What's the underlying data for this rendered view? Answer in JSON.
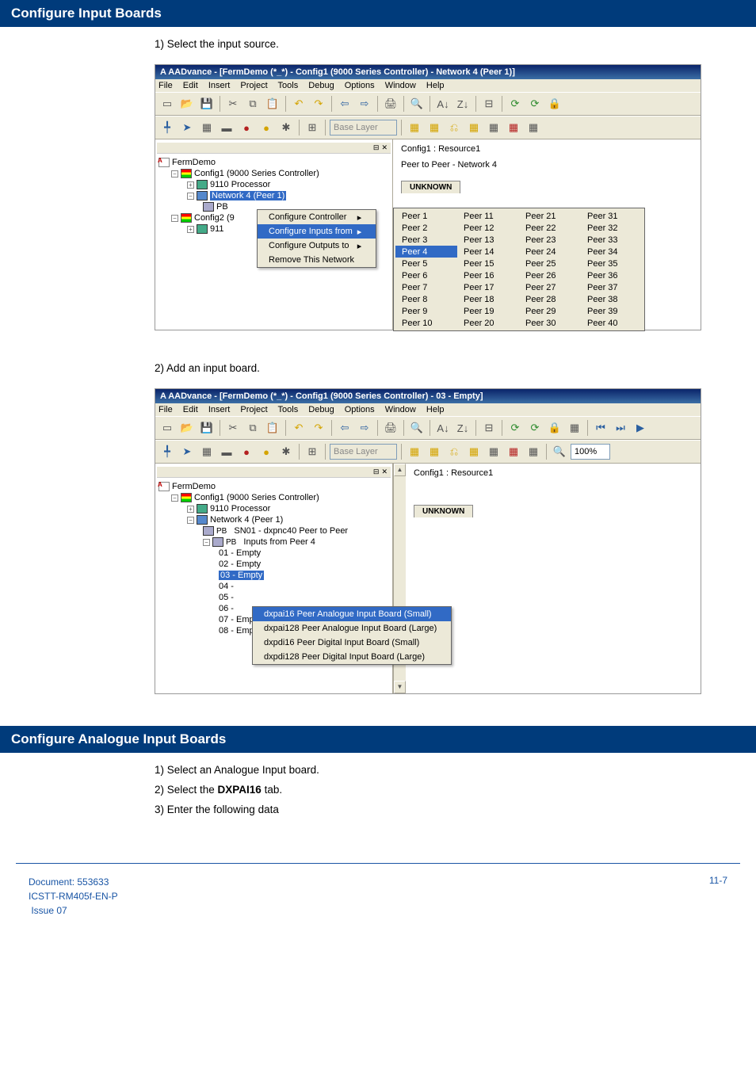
{
  "sections": {
    "configure_input": "Configure Input Boards",
    "configure_analogue": "Configure Analogue Input Boards"
  },
  "steps1": {
    "s1": "1)   Select the input source."
  },
  "steps2": {
    "s2": "2)   Add an input board."
  },
  "steps3": {
    "s1": "1)   Select an Analogue Input board.",
    "s2_a": "2)   Select the ",
    "s2_b": "DXPAI16",
    "s2_c": " tab.",
    "s3": "3)   Enter the following data"
  },
  "ss1": {
    "title": "AADvance - [FermDemo (*_*) - Config1 (9000 Series Controller) - Network 4 (Peer 1)]",
    "menu": {
      "file": "File",
      "edit": "Edit",
      "insert": "Insert",
      "project": "Project",
      "tools": "Tools",
      "debug": "Debug",
      "options": "Options",
      "window": "Window",
      "help": "Help"
    },
    "layer": "Base Layer",
    "main_header": "Config1 : Resource1",
    "main_sub": "Peer to Peer - Network 4",
    "main_tab": "UNKNOWN",
    "tree": {
      "root": "FermDemo",
      "c1": "Config1 (9000 Series Controller)",
      "proc": "9110 Processor",
      "net": "Network 4 (Peer 1)",
      "pb": "PB",
      "c2": "Config2 (9",
      "p2": "911"
    },
    "ctx": {
      "m1": "Configure Controller",
      "m2": "Configure Inputs from",
      "m3": "Configure Outputs to",
      "m4": "Remove This Network"
    },
    "peers": [
      [
        "Peer 1",
        "Peer 11",
        "Peer 21",
        "Peer 31"
      ],
      [
        "Peer 2",
        "Peer 12",
        "Peer 22",
        "Peer 32"
      ],
      [
        "Peer 3",
        "Peer 13",
        "Peer 23",
        "Peer 33"
      ],
      [
        "Peer 4",
        "Peer 14",
        "Peer 24",
        "Peer 34"
      ],
      [
        "Peer 5",
        "Peer 15",
        "Peer 25",
        "Peer 35"
      ],
      [
        "Peer 6",
        "Peer 16",
        "Peer 26",
        "Peer 36"
      ],
      [
        "Peer 7",
        "Peer 17",
        "Peer 27",
        "Peer 37"
      ],
      [
        "Peer 8",
        "Peer 18",
        "Peer 28",
        "Peer 38"
      ],
      [
        "Peer 9",
        "Peer 19",
        "Peer 29",
        "Peer 39"
      ],
      [
        "Peer 10",
        "Peer 20",
        "Peer 30",
        "Peer 40"
      ]
    ]
  },
  "ss2": {
    "title": "AADvance - [FermDemo (*_*) - Config1 (9000 Series Controller) - 03 - Empty]",
    "menu": {
      "file": "File",
      "edit": "Edit",
      "insert": "Insert",
      "project": "Project",
      "tools": "Tools",
      "debug": "Debug",
      "options": "Options",
      "window": "Window",
      "help": "Help"
    },
    "layer": "Base Layer",
    "zoom": "100%",
    "main_header": "Config1 : Resource1",
    "main_tab": "UNKNOWN",
    "tree": {
      "root": "FermDemo",
      "c1": "Config1 (9000 Series Controller)",
      "proc": "9110 Processor",
      "net": "Network 4 (Peer 1)",
      "sn": "SN01 - dxpnc40 Peer to Peer",
      "inputs": "Inputs from Peer 4",
      "i01": "01 - Empty",
      "i02": "02 - Empty",
      "i03": "03 - Empty",
      "i04": "04 -",
      "i05": "05 -",
      "i06": "06 -",
      "i07": "07 - Empty",
      "i08": "08 - Empty"
    },
    "ctx": {
      "o1": "dxpai16 Peer Analogue Input Board (Small)",
      "o2": "dxpai128 Peer Analogue Input Board (Large)",
      "o3": "dxpdi16 Peer Digital Input Board (Small)",
      "o4": "dxpdi128 Peer Digital Input Board (Large)"
    }
  },
  "footer": {
    "doc": "Document: 553633",
    "ref": "ICSTT-RM405f-EN-P",
    "issue": "Issue 07",
    "page": "11-7"
  }
}
